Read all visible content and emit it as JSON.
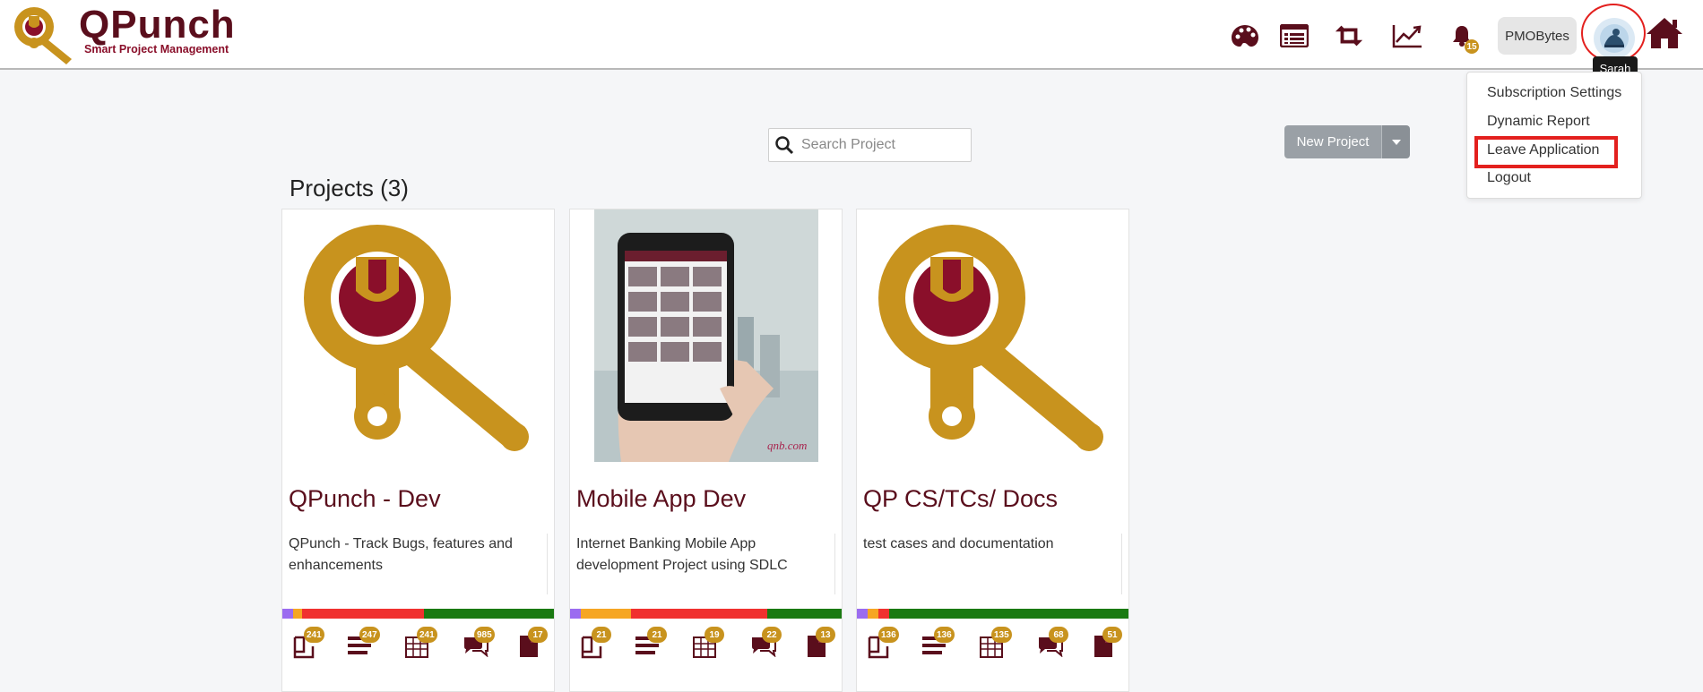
{
  "header": {
    "brand_name": "QPunch",
    "brand_tagline": "Smart Project Management",
    "icons": [
      "dashboard-icon",
      "list-icon",
      "retweet-icon",
      "trend-chart-icon",
      "bell-icon",
      "home-icon"
    ],
    "notification_count": "15",
    "org_label": "PMOBytes",
    "user_tooltip": "Sarah"
  },
  "user_menu": {
    "items": [
      "Subscription Settings",
      "Dynamic Report",
      "Leave Application",
      "Logout"
    ],
    "highlighted": "Leave Application"
  },
  "search": {
    "placeholder": "Search Project",
    "value": ""
  },
  "new_project": {
    "label": "New Project"
  },
  "projects": {
    "heading": "Projects (3)",
    "cards": [
      {
        "title": "QPunch - Dev",
        "description": "QPunch - Track Bugs, features and enhancements",
        "image": "qpunch-logo",
        "stats": [
          "241",
          "247",
          "241",
          "985",
          "17"
        ]
      },
      {
        "title": "Mobile App Dev",
        "description": "Internet Banking Mobile App development Project using SDLC",
        "image": "phone-photo",
        "image_caption": "qnb.com",
        "stats": [
          "21",
          "21",
          "19",
          "22",
          "13"
        ]
      },
      {
        "title": "QP CS/TCs/ Docs",
        "description": "test cases and documentation",
        "image": "qpunch-logo",
        "stats": [
          "136",
          "136",
          "135",
          "68",
          "51"
        ]
      }
    ]
  },
  "colors": {
    "brand_maroon": "#5a0e1c",
    "brand_gold": "#c8931e",
    "progress_purple": "#9b6cf0",
    "progress_orange": "#f6a623",
    "progress_red": "#f0312f",
    "progress_green": "#1a7a12",
    "highlight_red": "#e3201e"
  }
}
